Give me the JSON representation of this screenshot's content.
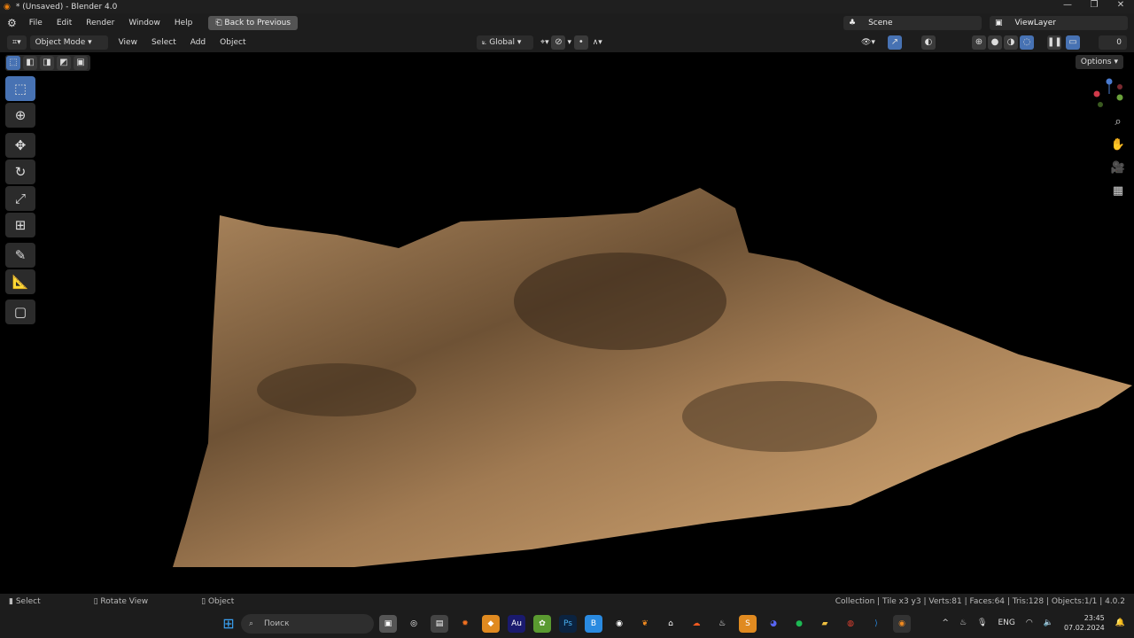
{
  "window": {
    "title": "* (Unsaved) - Blender 4.0",
    "minimize": "—",
    "maximize": "❐",
    "close": "✕"
  },
  "menu": [
    "File",
    "Edit",
    "Render",
    "Window",
    "Help"
  ],
  "back_button": "Back to Previous",
  "scene": "Scene",
  "view_layer": "ViewLayer",
  "header": {
    "mode": "Object Mode",
    "menus": [
      "View",
      "Select",
      "Add",
      "Object"
    ],
    "orientation": "Global",
    "options": "Options",
    "overlay_count": "0"
  },
  "status": {
    "left": "Select",
    "middle": "Rotate View",
    "right": "Object",
    "stats": "Collection | Tile x3 y3 | Verts:81 | Faces:64 | Tris:128 | Objects:1/1 | 4.0.2"
  },
  "taskbar": {
    "search_placeholder": "Поиск",
    "lang": "ENG",
    "time": "23:45",
    "date": "07.02.2024",
    "apps": [
      {
        "label": "Au",
        "color": "#1a1a6e"
      },
      {
        "label": "Ps",
        "color": "#0b2340"
      },
      {
        "label": "B",
        "color": "#2a8ae0"
      }
    ]
  }
}
